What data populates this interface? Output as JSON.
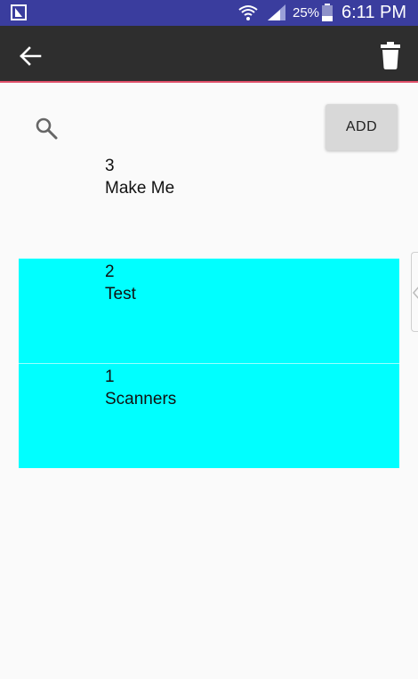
{
  "status_bar": {
    "battery_percent": "25%",
    "time": "6:11 PM",
    "icons": [
      "app-notification-icon",
      "wifi-icon",
      "signal-icon",
      "battery-icon"
    ]
  },
  "app_bar": {
    "back_icon": "arrow-back-icon",
    "delete_icon": "trash-icon",
    "accent_color": "#e0506a",
    "background_color": "#2e2e2e"
  },
  "toolbar": {
    "search_icon": "search-icon",
    "add_label": "ADD"
  },
  "items": [
    {
      "number": "3",
      "name": "Make Me",
      "selected": false
    },
    {
      "number": "2",
      "name": "Test",
      "selected": true
    },
    {
      "number": "1",
      "name": "Scanners",
      "selected": true
    }
  ],
  "colors": {
    "selected_row": "#00ffff",
    "status_bar": "#3a3d9e",
    "page_background": "#fafafa"
  }
}
